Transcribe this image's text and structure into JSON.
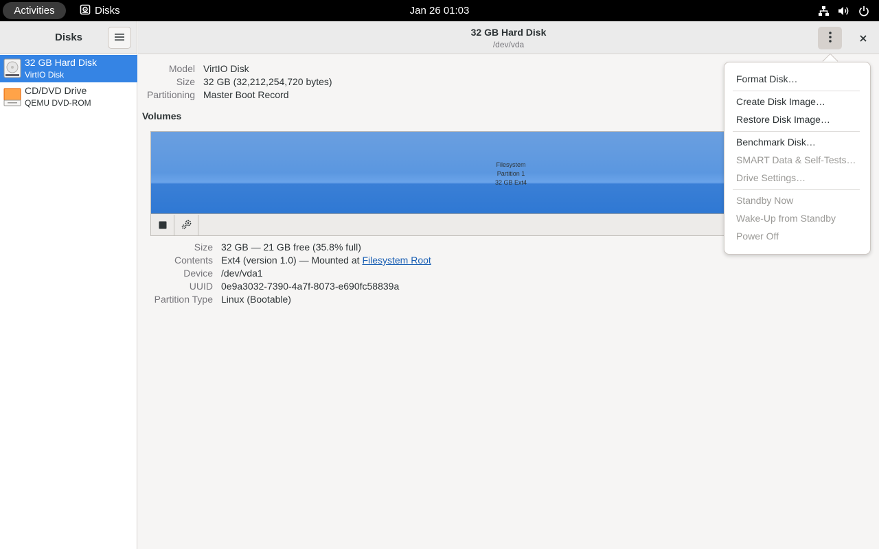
{
  "topbar": {
    "activities": "Activities",
    "app_name": "Disks",
    "clock": "Jan 26  01:03"
  },
  "sidebar": {
    "title": "Disks",
    "drives": [
      {
        "name": "32 GB Hard Disk",
        "sub": "VirtIO Disk",
        "selected": true
      },
      {
        "name": "CD/DVD Drive",
        "sub": "QEMU DVD-ROM",
        "selected": false
      }
    ]
  },
  "header": {
    "title": "32 GB Hard Disk",
    "subtitle": "/dev/vda"
  },
  "disk_info": {
    "model_label": "Model",
    "model_value": "VirtIO Disk",
    "size_label": "Size",
    "size_value": "32 GB (32,212,254,720 bytes)",
    "partitioning_label": "Partitioning",
    "partitioning_value": "Master Boot Record"
  },
  "volumes": {
    "title": "Volumes",
    "partition_lines": [
      "Filesystem",
      "Partition 1",
      "32 GB Ext4"
    ]
  },
  "details": {
    "size_label": "Size",
    "size_value": "32 GB — 21 GB free (35.8% full)",
    "contents_label": "Contents",
    "contents_value": "Ext4 (version 1.0) — Mounted at ",
    "contents_link": "Filesystem Root",
    "device_label": "Device",
    "device_value": "/dev/vda1",
    "uuid_label": "UUID",
    "uuid_value": "0e9a3032-7390-4a7f-8073-e690fc58839a",
    "ptype_label": "Partition Type",
    "ptype_value": "Linux (Bootable)"
  },
  "menu": {
    "format": "Format Disk…",
    "create_image": "Create Disk Image…",
    "restore_image": "Restore Disk Image…",
    "benchmark": "Benchmark Disk…",
    "smart": "SMART Data & Self-Tests…",
    "drive_settings": "Drive Settings…",
    "standby": "Standby Now",
    "wakeup": "Wake-Up from Standby",
    "power_off": "Power Off"
  },
  "colors": {
    "accent": "#3584e4",
    "partition": "#3a7fd6",
    "link": "#1a5fb4",
    "danger": "#c01c28"
  }
}
